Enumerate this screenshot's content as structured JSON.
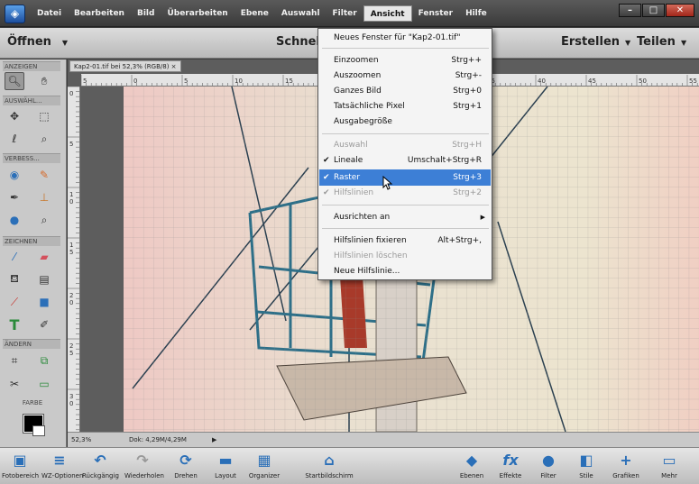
{
  "menubar": {
    "items": [
      "Datei",
      "Bearbeiten",
      "Bild",
      "Überarbeiten",
      "Ebene",
      "Auswahl",
      "Filter",
      "Ansicht",
      "Fenster",
      "Hilfe"
    ],
    "active": "Ansicht"
  },
  "subbar": {
    "open_label": "Öffnen",
    "mode_label": "Schnell",
    "create_label": "Erstellen",
    "share_label": "Teilen"
  },
  "toolbox": {
    "sections": [
      "ANZEIGEN",
      "AUSWÄHL...",
      "VERBESS...",
      "ZEICHNEN",
      "ÄNDERN",
      "FARBE"
    ]
  },
  "document": {
    "tab_label": "Kap2-01.tif bei 52,3% (RGB/8)",
    "tab_close": "×",
    "h_ruler_labels": [
      "5",
      "0",
      "5",
      "10",
      "15",
      "20",
      "25",
      "30",
      "35",
      "40",
      "45",
      "50",
      "55"
    ],
    "v_ruler_labels": [
      "0",
      "5",
      "1\n0",
      "1\n5",
      "2\n0",
      "2\n5",
      "3\n0"
    ]
  },
  "status": {
    "zoom": "52,3%",
    "doc_info": "Dok: 4,29M/4,29M",
    "arrow": "▶"
  },
  "taskbar": [
    {
      "label": "Fotobereich",
      "icon": "photo-bin-icon"
    },
    {
      "label": "WZ-Optionen",
      "icon": "tool-options-icon"
    },
    {
      "label": "Rückgängig",
      "icon": "undo-icon"
    },
    {
      "label": "Wiederholen",
      "icon": "redo-icon"
    },
    {
      "label": "Drehen",
      "icon": "rotate-icon"
    },
    {
      "label": "Layout",
      "icon": "layout-icon"
    },
    {
      "label": "Organizer",
      "icon": "organizer-icon"
    },
    {
      "label": "Startbildschirm",
      "icon": "home-screen-icon"
    },
    {
      "label": "Ebenen",
      "icon": "layers-icon"
    },
    {
      "label": "Effekte",
      "icon": "effects-icon"
    },
    {
      "label": "Filter",
      "icon": "filter-icon"
    },
    {
      "label": "Stile",
      "icon": "styles-icon"
    },
    {
      "label": "Grafiken",
      "icon": "graphics-icon"
    },
    {
      "label": "Mehr",
      "icon": "more-icon"
    }
  ],
  "view_menu": [
    {
      "label": "Neues Fenster für \"Kap2-01.tif\"",
      "shortcut": ""
    },
    {
      "label": "Einzoomen",
      "shortcut": "Strg++"
    },
    {
      "label": "Auszoomen",
      "shortcut": "Strg+-"
    },
    {
      "label": "Ganzes Bild",
      "shortcut": "Strg+0"
    },
    {
      "label": "Tatsächliche Pixel",
      "shortcut": "Strg+1"
    },
    {
      "label": "Ausgabegröße",
      "shortcut": ""
    },
    {
      "label": "Auswahl",
      "shortcut": "Strg+H",
      "disabled": true
    },
    {
      "label": "Lineale",
      "shortcut": "Umschalt+Strg+R",
      "checked": true
    },
    {
      "label": "Raster",
      "shortcut": "Strg+3",
      "checked": true,
      "highlighted": true
    },
    {
      "label": "Hilfslinien",
      "shortcut": "Strg+2",
      "checked": true,
      "disabled": true
    },
    {
      "label": "Ausrichten an",
      "shortcut": "",
      "submenu": true
    },
    {
      "label": "Hilfslinien fixieren",
      "shortcut": "Alt+Strg+,"
    },
    {
      "label": "Hilfslinien löschen",
      "shortcut": "",
      "disabled": true
    },
    {
      "label": "Neue Hilfslinie...",
      "shortcut": ""
    }
  ],
  "colors": {
    "highlight": "#3d7fd6",
    "accent": "#2a6fb8"
  }
}
